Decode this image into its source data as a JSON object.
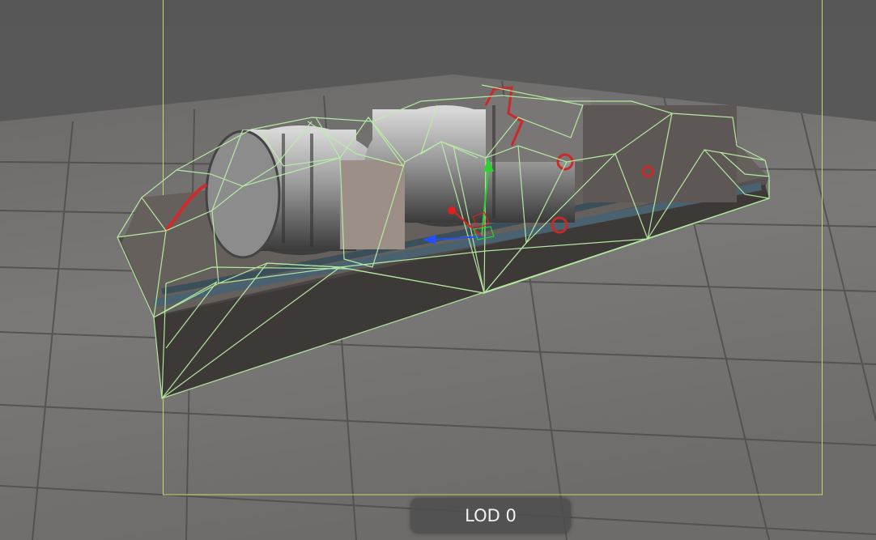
{
  "viewport": {
    "lod_label": "LOD 0",
    "colors": {
      "background": "#5a5a5a",
      "floor": "#7a7877",
      "wireframe": "#b8f0a4",
      "bounds": "#c8d86a",
      "gizmo_x": "#e02020",
      "gizmo_y": "#30d030",
      "gizmo_z": "#2050ff"
    },
    "icons": [
      "transform-gizmo-icon"
    ]
  }
}
